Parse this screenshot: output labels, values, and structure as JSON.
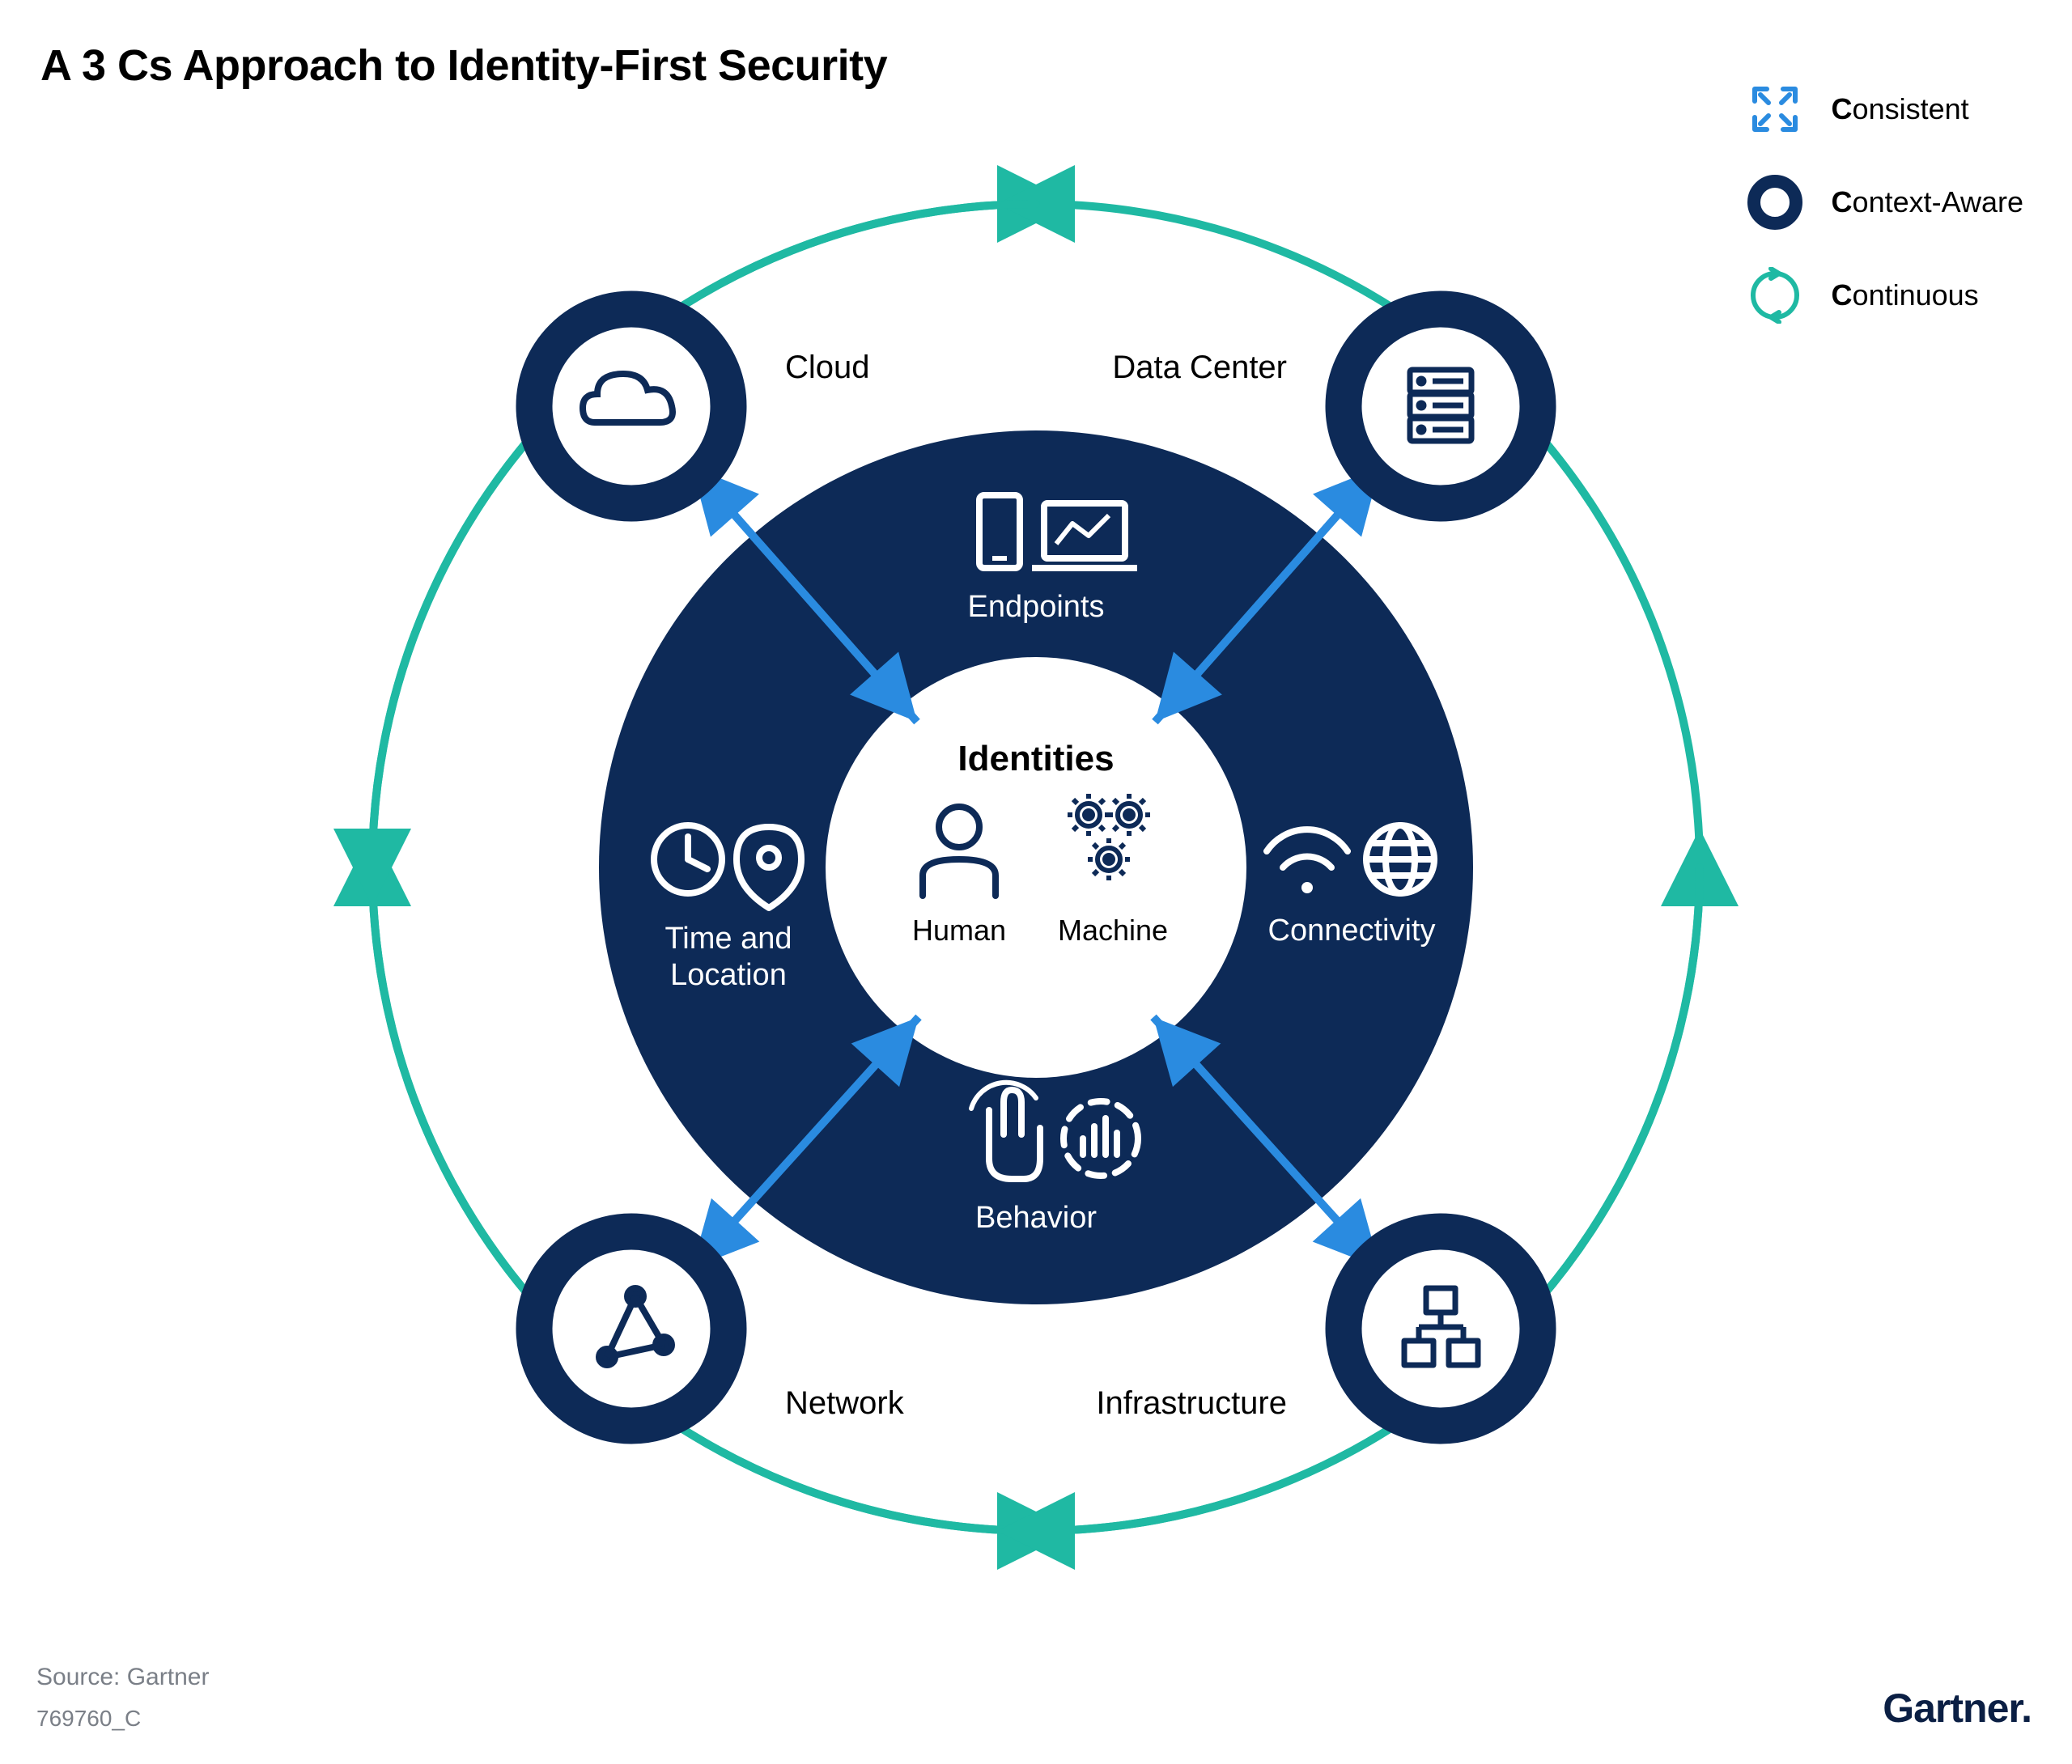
{
  "title": "A 3 Cs Approach to Identity-First Security",
  "legend": {
    "consistent": "onsistent",
    "context": "ontext-Aware",
    "continuous": "ontinuous"
  },
  "center": {
    "title": "Identities",
    "human": "Human",
    "machine": "Machine"
  },
  "ring": {
    "endpoints": "Endpoints",
    "connectivity": "Connectivity",
    "behavior": "Behavior",
    "timeloc1": "Time and",
    "timeloc2": "Location"
  },
  "outer": {
    "cloud": "Cloud",
    "datacenter": "Data Center",
    "network": "Network",
    "infrastructure": "Infrastructure"
  },
  "source": "Source: Gartner",
  "figid": "769760_C",
  "brand": "Gartner",
  "colors": {
    "navy": "#0d2a57",
    "teal": "#1fb9a3",
    "blue": "#2a8be0",
    "gray": "#7a7f87"
  }
}
